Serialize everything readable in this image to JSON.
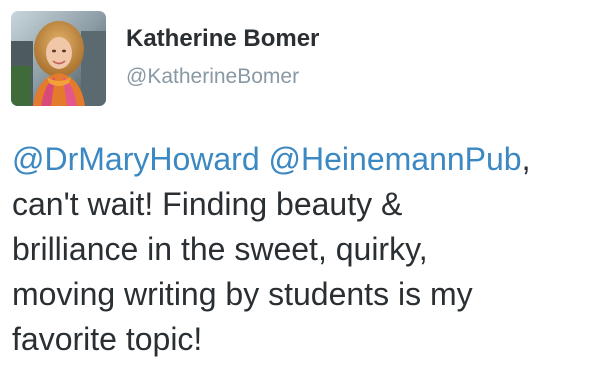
{
  "author": {
    "display_name": "Katherine Bomer",
    "screen_name": "@KatherineBomer"
  },
  "tweet": {
    "mention_1": "@DrMaryHoward",
    "mention_2": "@HeinemannPub",
    "line_1_trail": ",",
    "line_2": "can't wait! Finding beauty &",
    "line_3": "brilliance in the sweet, quirky,",
    "line_4": "moving writing by students is my",
    "line_5": "favorite topic!"
  },
  "colors": {
    "text": "#292f33",
    "link": "#3b88c3",
    "muted": "#8899a6",
    "background": "#ffffff"
  }
}
